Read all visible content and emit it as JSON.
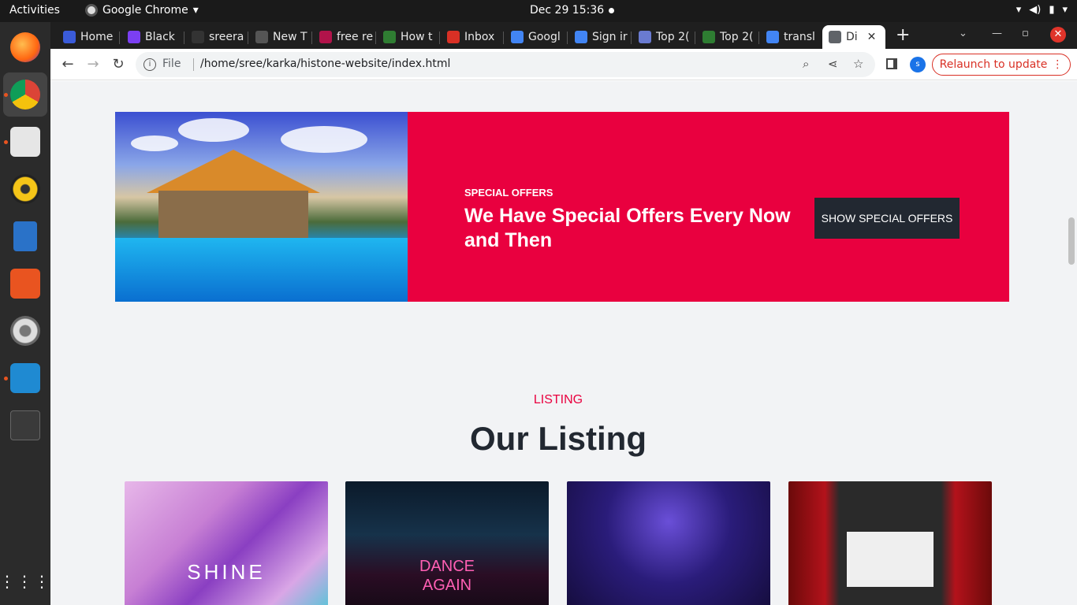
{
  "system": {
    "activities": "Activities",
    "app_name": "Google Chrome",
    "datetime": "Dec 29  15:36"
  },
  "tabs": [
    {
      "label": "Home",
      "color": "#3a5bd9"
    },
    {
      "label": "Black",
      "color": "#7b3ff2"
    },
    {
      "label": "sreera",
      "color": "#333333"
    },
    {
      "label": "New T",
      "color": "#555555"
    },
    {
      "label": "free re",
      "color": "#b1134a"
    },
    {
      "label": "How t",
      "color": "#2f7d32"
    },
    {
      "label": "Inbox",
      "color": "#d93025"
    },
    {
      "label": "Googl",
      "color": "#4285f4"
    },
    {
      "label": "Sign ir",
      "color": "#4285f4"
    },
    {
      "label": "Top 2(",
      "color": "#6a7bd1"
    },
    {
      "label": "Top 2(",
      "color": "#2e7d32"
    },
    {
      "label": "transl",
      "color": "#4285f4"
    },
    {
      "label": "Di",
      "color": "#5f6368"
    }
  ],
  "browser": {
    "scheme": "File",
    "url": "/home/sree/karka/histone-website/index.html",
    "profile_initial": "s",
    "relaunch_label": "Relaunch to update"
  },
  "promo": {
    "kicker": "SPECIAL OFFERS",
    "headline": "We Have Special Offers Every Now and Then",
    "button_label": "SHOW SPECIAL OFFERS"
  },
  "listing": {
    "kicker": "LISTING",
    "title": "Our Listing",
    "cards": [
      {
        "caption": "SHINE"
      },
      {
        "caption": "DANCE AGAIN"
      },
      {
        "caption": ""
      },
      {
        "caption": ""
      }
    ]
  },
  "colors": {
    "accent": "#e9003f",
    "dark": "#222831",
    "page_bg": "#f2f3f5"
  }
}
